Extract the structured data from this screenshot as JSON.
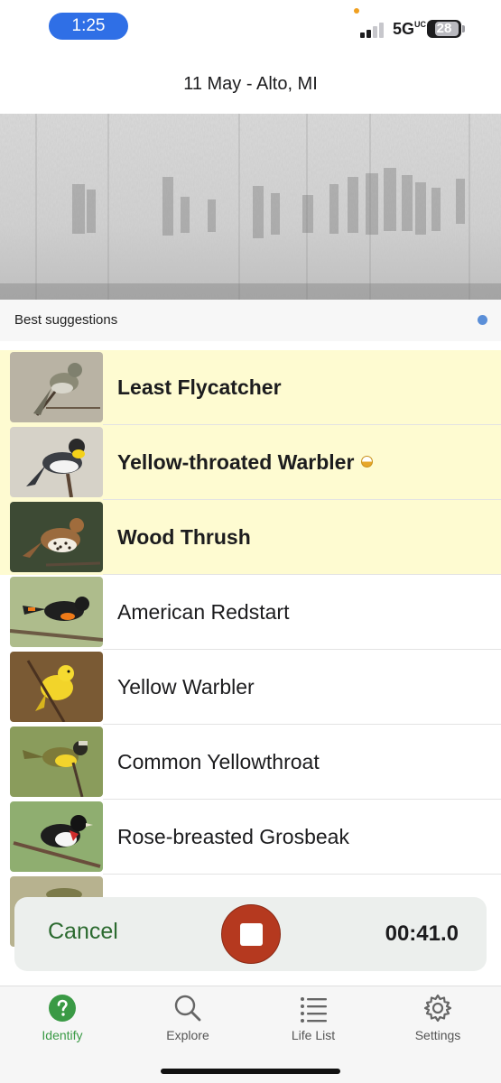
{
  "status_bar": {
    "time": "1:25",
    "network": "5G",
    "network_sup": "UC",
    "battery": "28"
  },
  "header": {
    "title": "11 May - Alto, MI"
  },
  "suggestions": {
    "label": "Best suggestions"
  },
  "birds": [
    {
      "name": "Least Flycatcher",
      "best": true,
      "icon": "least-flycatcher-photo"
    },
    {
      "name": "Yellow-throated Warbler",
      "best": true,
      "icon": "yellow-throated-warbler-photo",
      "badge": "half-circle-icon"
    },
    {
      "name": "Wood Thrush",
      "best": true,
      "icon": "wood-thrush-photo"
    },
    {
      "name": "American Redstart",
      "best": false,
      "icon": "american-redstart-photo"
    },
    {
      "name": "Yellow Warbler",
      "best": false,
      "icon": "yellow-warbler-photo"
    },
    {
      "name": "Common Yellowthroat",
      "best": false,
      "icon": "common-yellowthroat-photo"
    },
    {
      "name": "Rose-breasted Grosbeak",
      "best": false,
      "icon": "rose-breasted-grosbeak-photo"
    },
    {
      "name": "",
      "best": false,
      "icon": "partial-bird-photo"
    }
  ],
  "recording": {
    "cancel_label": "Cancel",
    "timer": "00:41.0"
  },
  "tabs": [
    {
      "label": "Identify",
      "icon": "question-circle-icon",
      "active": true
    },
    {
      "label": "Explore",
      "icon": "magnifier-icon",
      "active": false
    },
    {
      "label": "Life List",
      "icon": "list-icon",
      "active": false
    },
    {
      "label": "Settings",
      "icon": "gear-icon",
      "active": false
    }
  ],
  "colors": {
    "accent_green": "#3a9a45",
    "cancel_green": "#2b6a2f",
    "stop_red": "#b5391f",
    "best_row_bg": "#fefbd1",
    "time_pill": "#2f6fe6"
  }
}
